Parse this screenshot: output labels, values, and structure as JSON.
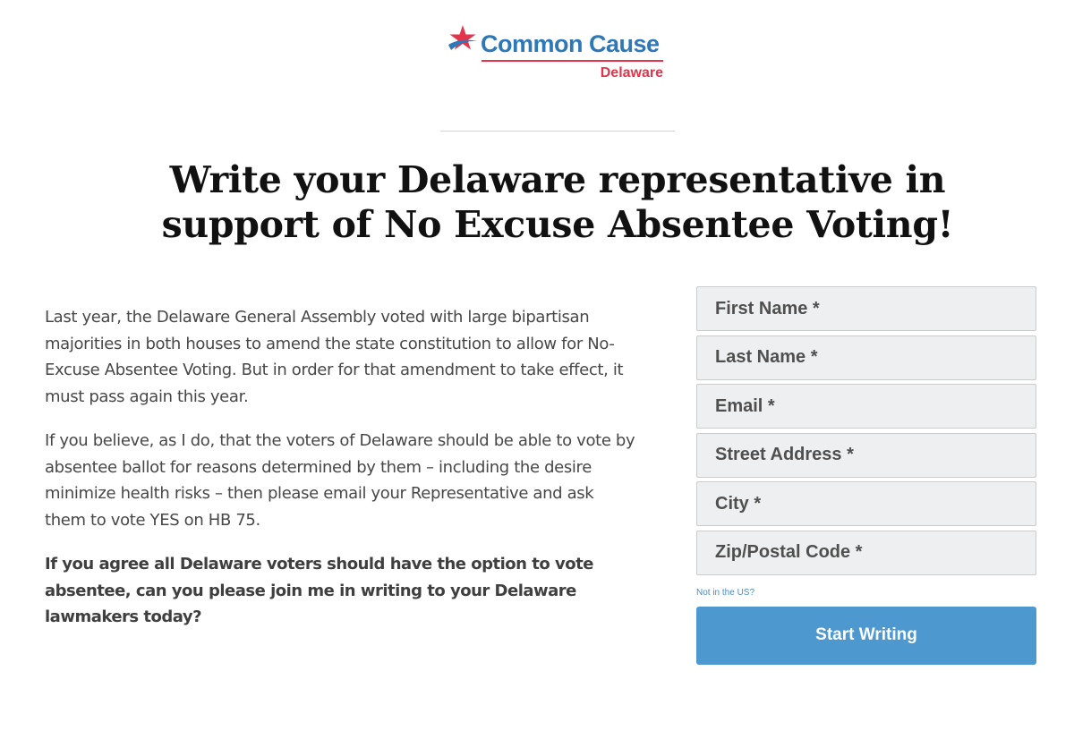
{
  "logo": {
    "name": "Common Cause",
    "state": "Delaware",
    "star_color": "#e3344b",
    "swoosh_color": "#2f78b8"
  },
  "headline": "Write your Delaware representative in support of No Excuse Absentee Voting!",
  "body": {
    "paragraph_1": "Last year, the Delaware General Assembly voted with large bipartisan majorities in both houses to amend the state constitution to allow for No-Excuse Absentee Voting. But in order for that amendment to take effect, it must pass again this year.",
    "paragraph_2": "If you believe, as I do, that the voters of Delaware should be able to vote by absentee ballot for reasons determined by them – including the desire minimize health risks – then please email your Representative and ask them to vote YES on HB 75.",
    "paragraph_3": "If you agree all Delaware voters should have the option to vote absentee, can you please join me in writing to your Delaware lawmakers today?"
  },
  "form": {
    "first_name": {
      "placeholder": "First Name *",
      "value": ""
    },
    "last_name": {
      "placeholder": "Last Name *",
      "value": ""
    },
    "email": {
      "placeholder": "Email *",
      "value": ""
    },
    "street": {
      "placeholder": "Street Address *",
      "value": ""
    },
    "city": {
      "placeholder": "City *",
      "value": ""
    },
    "zip": {
      "placeholder": "Zip/Postal Code *",
      "value": ""
    },
    "not_us_link": "Not in the US?",
    "submit_label": "Start Writing"
  },
  "colors": {
    "brand_blue": "#2f78b8",
    "brand_red": "#e3344b",
    "button": "#4d98cf",
    "field_bg": "#eeeff0"
  }
}
